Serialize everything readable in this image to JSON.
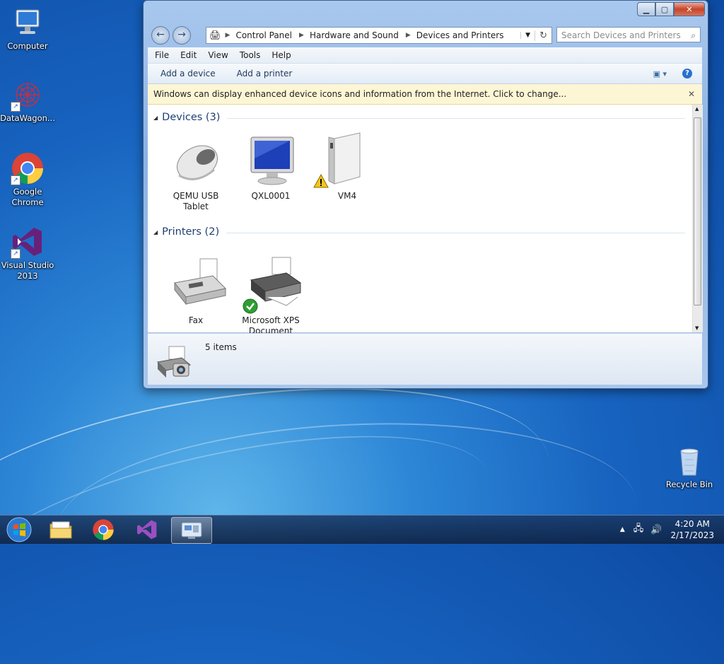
{
  "desktop": {
    "icons": [
      {
        "label": "Computer"
      },
      {
        "label": "DataWagon..."
      },
      {
        "label": "Google\nChrome"
      },
      {
        "label": "Visual Studio\n2013"
      }
    ],
    "recycle_bin": "Recycle Bin"
  },
  "address": {
    "crumbs": [
      "Control Panel",
      "Hardware and Sound",
      "Devices and Printers"
    ],
    "search_placeholder": "Search Devices and Printers"
  },
  "menu": [
    "File",
    "Edit",
    "View",
    "Tools",
    "Help"
  ],
  "commands": {
    "add_device": "Add a device",
    "add_printer": "Add a printer"
  },
  "info_bar": "Windows can display enhanced device icons and information from the Internet. Click to change...",
  "groups": {
    "devices": {
      "title": "Devices (3)",
      "items": [
        {
          "label": "QEMU USB\nTablet",
          "icon": "mouse-icon"
        },
        {
          "label": "QXL0001",
          "icon": "monitor-icon"
        },
        {
          "label": "VM4",
          "icon": "computer-tower-icon",
          "badge": "warning"
        }
      ]
    },
    "printers": {
      "title": "Printers (2)",
      "items": [
        {
          "label": "Fax",
          "icon": "fax-icon"
        },
        {
          "label": "Microsoft XPS\nDocument Writer",
          "icon": "printer-icon",
          "badge": "default-check"
        }
      ]
    }
  },
  "details": {
    "count": "5 items"
  },
  "taskbar": {
    "clock_time": "4:20 AM",
    "clock_date": "2/17/2023"
  }
}
